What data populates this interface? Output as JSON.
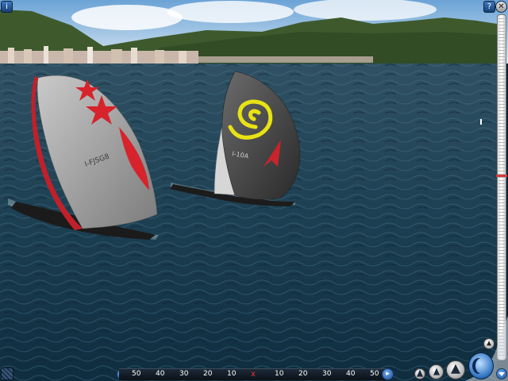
{
  "scene": {
    "boat_left_sail_number": "I-FJSG8",
    "boat_right_sail_number": "I-10A"
  },
  "colors": {
    "sky": "#9fc6e6",
    "hills": "#3f5a2e",
    "sea": "#173a4e",
    "accent_blue": "#2a6fc0",
    "scale_marker": "#e33333"
  },
  "icons": {
    "top_left": "info-icon",
    "top_right_1": "question-icon",
    "top_right_2": "close-icon",
    "bottom_left": "map-icon",
    "bottom_right_large": "moon-icon"
  },
  "bottom_bar": {
    "left_ticks": [
      "50",
      "40",
      "30",
      "20",
      "10"
    ],
    "right_ticks": [
      "10",
      "20",
      "30",
      "40",
      "50"
    ],
    "center_marker": "x"
  },
  "vertical_scale": {
    "marker_level": 0.46
  }
}
